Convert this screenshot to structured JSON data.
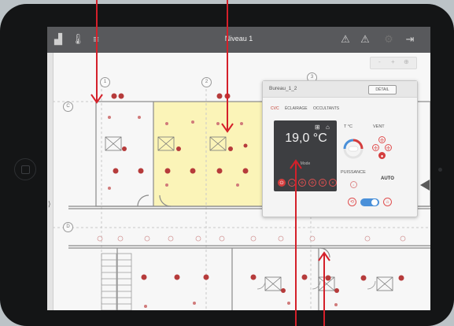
{
  "app": {
    "level_title": "Niveau 1",
    "toolbar_left_icons": [
      "building-icon",
      "thermometer-icon",
      "filter-list-icon"
    ],
    "toolbar_right_icons": [
      "warning-icon",
      "warning-list-icon",
      "settings-icon",
      "logout-icon"
    ]
  },
  "plan": {
    "grid_labels": [
      "1",
      "2",
      "3",
      "C",
      "D"
    ],
    "zoom_controls": [
      "-",
      "+",
      "⊕"
    ]
  },
  "panel": {
    "room_name": "Bureau_1_2",
    "detail_label": "DÉTAIL",
    "tabs": [
      "CVC",
      "ÉCLAIRAGE",
      "OCCULTANTS"
    ],
    "temperature": "19,0 °C",
    "mode_label": "Mode",
    "temp_label": "T °C",
    "vent_label": "VENT",
    "power_label": "PUISSANCE",
    "auto_label": "AUTO",
    "accent_color": "#d43d3d",
    "toggle_color": "#4a90d9"
  }
}
